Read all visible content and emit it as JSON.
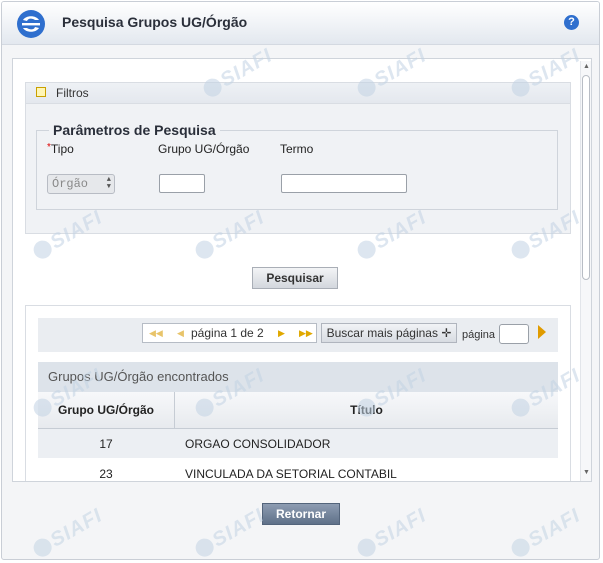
{
  "window": {
    "title": "Pesquisa Grupos UG/Órgão",
    "help_label": "?"
  },
  "filters": {
    "header": "Filtros",
    "fieldset_legend": "Parâmetros de Pesquisa",
    "tipo_label": "Tipo",
    "tipo_required_mark": "*",
    "tipo_value": "Órgão",
    "grupo_label": "Grupo UG/Órgão",
    "grupo_value": "",
    "termo_label": "Termo",
    "termo_value": ""
  },
  "search_button": "Pesquisar",
  "pagination": {
    "first": "◀◀",
    "prev": "◀",
    "page_text": "página 1 de 2",
    "next": "▶",
    "last": "▶▶",
    "more_pages": "Buscar mais páginas",
    "more_icon": "✛",
    "page_label": "página",
    "page_value": ""
  },
  "grid": {
    "caption": "Grupos UG/Órgão encontrados",
    "columns": [
      "Grupo UG/Órgão",
      "Título"
    ],
    "rows": [
      {
        "grupo": "17",
        "titulo": "ORGAO CONSOLIDADOR"
      },
      {
        "grupo": "23",
        "titulo": "VINCULADA DA SETORIAL CONTABIL"
      }
    ]
  },
  "footer": {
    "return_button": "Retornar"
  },
  "watermark_text": "SIAFI",
  "colors": {
    "accent_blue": "#2f6fce",
    "button_dark": "#5f7189",
    "pager_arrow": "#e09b00"
  }
}
